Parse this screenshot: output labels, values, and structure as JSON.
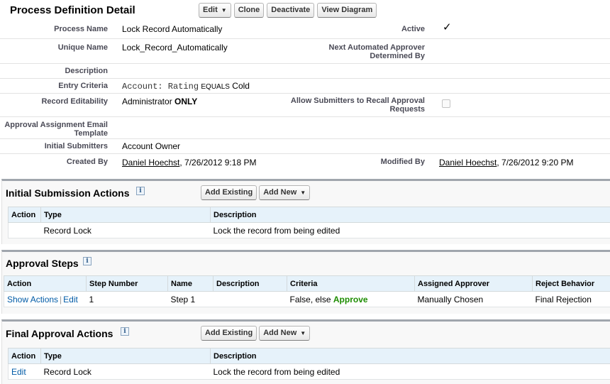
{
  "detail": {
    "title": "Process Definition Detail",
    "buttons": {
      "edit": "Edit",
      "clone": "Clone",
      "deactivate": "Deactivate",
      "view_diagram": "View Diagram"
    },
    "rows": {
      "process_name": {
        "label": "Process Name",
        "value": "Lock Record Automatically"
      },
      "active": {
        "label": "Active",
        "value": "✓"
      },
      "unique_name": {
        "label": "Unique Name",
        "value": "Lock_Record_Automatically"
      },
      "next_approver": {
        "label": "Next Automated Approver Determined By",
        "value": ""
      },
      "description": {
        "label": "Description",
        "value": ""
      },
      "entry_criteria": {
        "label": "Entry Criteria",
        "field": "Account: Rating",
        "operator": "EQUALS",
        "value": "Cold"
      },
      "record_editability": {
        "label": "Record Editability",
        "value": "Administrator",
        "emphasis": "ONLY"
      },
      "allow_recall": {
        "label": "Allow Submitters to Recall Approval Requests",
        "checked": false
      },
      "email_template": {
        "label": "Approval Assignment Email Template",
        "value": ""
      },
      "initial_submitters": {
        "label": "Initial Submitters",
        "value": "Account Owner"
      },
      "created_by": {
        "label": "Created By",
        "user": "Daniel Hoechst",
        "date": ", 7/26/2012 9:18 PM"
      },
      "modified_by": {
        "label": "Modified By",
        "user": "Daniel Hoechst",
        "date": ", 7/26/2012 9:20 PM"
      }
    }
  },
  "initial_submission": {
    "title": "Initial Submission Actions",
    "add_existing": "Add Existing",
    "add_new": "Add New",
    "columns": [
      "Action",
      "Type",
      "Description"
    ],
    "rows": [
      {
        "action": "",
        "type": "Record Lock",
        "description": "Lock the record from being edited"
      }
    ]
  },
  "approval_steps": {
    "title": "Approval Steps",
    "columns": [
      "Action",
      "Step Number",
      "Name",
      "Description",
      "Criteria",
      "Assigned Approver",
      "Reject Behavior"
    ],
    "rows": [
      {
        "show_actions": "Show Actions",
        "separator": "|",
        "edit": "Edit",
        "step_number": "1",
        "name": "Step 1",
        "description": "",
        "criteria_prefix": "False, else",
        "criteria_result": "Approve",
        "assigned_approver": "Manually Chosen",
        "reject_behavior": "Final Rejection"
      }
    ]
  },
  "final_approval": {
    "title": "Final Approval Actions",
    "add_existing": "Add Existing",
    "add_new": "Add New",
    "columns": [
      "Action",
      "Type",
      "Description"
    ],
    "rows": [
      {
        "action": "Edit",
        "type": "Record Lock",
        "description": "Lock the record from being edited"
      }
    ]
  },
  "colors": {
    "link": "#015ba7",
    "approve_green": "#1d8d00",
    "header_bg": "#e6f2fa",
    "section_border": "#a0a6ad"
  }
}
